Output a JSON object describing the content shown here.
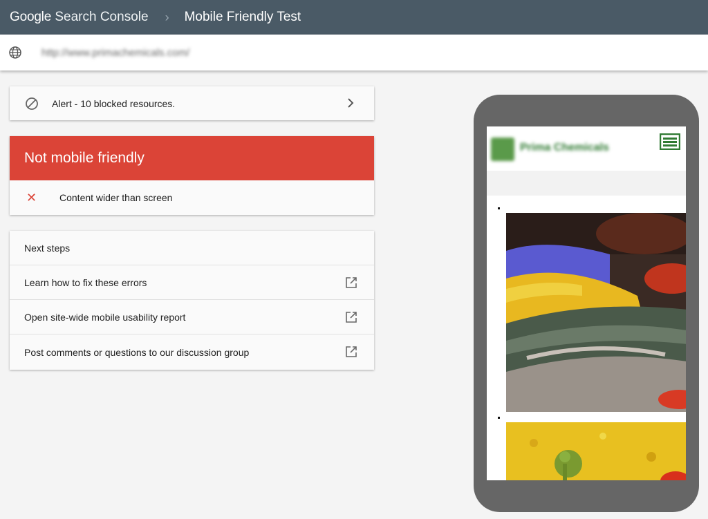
{
  "header": {
    "brand_google": "Google",
    "brand_product": "Search Console",
    "separator": "›",
    "title": "Mobile Friendly Test"
  },
  "url_bar": {
    "icon": "globe-icon",
    "url": "http://www.primachemicals.com/"
  },
  "alert": {
    "icon": "blocked-icon",
    "text": "Alert - 10 blocked resources.",
    "chevron_icon": "chevron-right-icon"
  },
  "verdict": {
    "title": "Not mobile friendly",
    "issues": [
      {
        "icon": "error-x-icon",
        "mark": "✕",
        "text": "Content wider than screen"
      }
    ]
  },
  "next_steps": {
    "title": "Next steps",
    "items": [
      {
        "label": "Learn how to fix these errors",
        "icon": "external-link-icon"
      },
      {
        "label": "Open site-wide mobile usability report",
        "icon": "external-link-icon"
      },
      {
        "label": "Post comments or questions to our discussion group",
        "icon": "external-link-icon"
      }
    ]
  },
  "phone_preview": {
    "site_name": "Prima Chemicals",
    "menu_icon": "hamburger-menu-icon"
  },
  "colors": {
    "header_bg": "#4a5a66",
    "error_red": "#db4437",
    "brand_green": "#2f7a32",
    "phone_frame": "#666666"
  }
}
